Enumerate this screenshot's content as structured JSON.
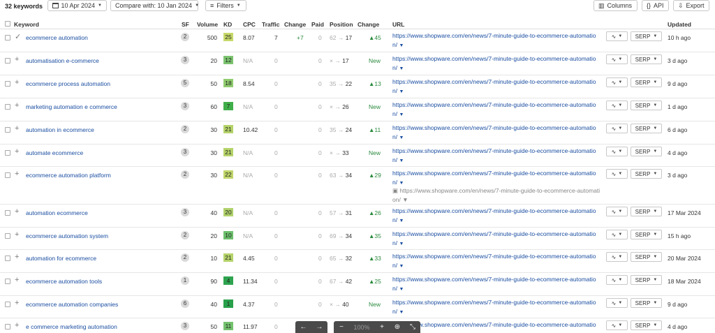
{
  "toolbar": {
    "keyword_count": "32 keywords",
    "date_label": "10 Apr 2024",
    "compare_label": "Compare with: 10 Jan 2024",
    "filters_label": "Filters",
    "columns_label": "Columns",
    "api_label": "API",
    "export_label": "Export"
  },
  "headers": {
    "keyword": "Keyword",
    "sf": "SF",
    "volume": "Volume",
    "kd": "KD",
    "cpc": "CPC",
    "traffic": "Traffic",
    "change": "Change",
    "paid": "Paid",
    "position": "Position",
    "pos_change": "Change",
    "url": "URL",
    "updated": "Updated"
  },
  "serp_label": "SERP",
  "rows": [
    {
      "keyword": "ecommerce automation",
      "sf": "2",
      "volume": "500",
      "kd": "25",
      "kd_color": "#c7d96b",
      "cpc": "8.07",
      "traffic": "7",
      "traffic_change": "+7",
      "paid": "0",
      "pos_from": "62",
      "pos_to": "17",
      "pos_change": "▲45",
      "url": "https://www.shopware.com/en/news/7-minute-guide-to-ecommerce-automatio n/",
      "updated": "10 h ago"
    },
    {
      "keyword": "automatisation e-commerce",
      "sf": "3",
      "volume": "20",
      "kd": "12",
      "kd_color": "#7cc46f",
      "cpc": "N/A",
      "traffic": "0",
      "traffic_change": "",
      "paid": "0",
      "pos_from": "×",
      "pos_to": "17",
      "pos_change": "New",
      "url": "https://www.shopware.com/en/news/7-minute-guide-to-ecommerce-automatio n/",
      "updated": "3 d ago"
    },
    {
      "keyword": "ecommerce process automation",
      "sf": "5",
      "volume": "50",
      "kd": "18",
      "kd_color": "#8fcc6e",
      "cpc": "8.54",
      "traffic": "0",
      "traffic_change": "",
      "paid": "0",
      "pos_from": "35",
      "pos_to": "22",
      "pos_change": "▲13",
      "url": "https://www.shopware.com/en/news/7-minute-guide-to-ecommerce-automatio n/",
      "updated": "9 d ago"
    },
    {
      "keyword": "marketing automation e commerce",
      "sf": "3",
      "volume": "60",
      "kd": "7",
      "kd_color": "#3fae49",
      "cpc": "N/A",
      "traffic": "0",
      "traffic_change": "",
      "paid": "0",
      "pos_from": "×",
      "pos_to": "26",
      "pos_change": "New",
      "url": "https://www.shopware.com/en/news/7-minute-guide-to-ecommerce-automatio n/",
      "updated": "1 d ago"
    },
    {
      "keyword": "automation in ecommerce",
      "sf": "2",
      "volume": "30",
      "kd": "21",
      "kd_color": "#b5d36a",
      "cpc": "10.42",
      "traffic": "0",
      "traffic_change": "",
      "paid": "0",
      "pos_from": "35",
      "pos_to": "24",
      "pos_change": "▲11",
      "url": "https://www.shopware.com/en/news/7-minute-guide-to-ecommerce-automatio n/",
      "updated": "6 d ago"
    },
    {
      "keyword": "automate ecommerce",
      "sf": "3",
      "volume": "30",
      "kd": "21",
      "kd_color": "#b5d36a",
      "cpc": "N/A",
      "traffic": "0",
      "traffic_change": "",
      "paid": "0",
      "pos_from": "×",
      "pos_to": "33",
      "pos_change": "New",
      "url": "https://www.shopware.com/en/news/7-minute-guide-to-ecommerce-automatio n/",
      "updated": "4 d ago"
    },
    {
      "keyword": "ecommerce automation platform",
      "sf": "2",
      "volume": "30",
      "kd": "22",
      "kd_color": "#c0d66b",
      "cpc": "N/A",
      "traffic": "0",
      "traffic_change": "",
      "paid": "0",
      "pos_from": "63",
      "pos_to": "34",
      "pos_change": "▲29",
      "url": "https://www.shopware.com/en/news/7-minute-guide-to-ecommerce-automatio n/",
      "url_secondary": "https://www.shopware.com/en/news/7-minute-guide-to-ecommerce-automation/",
      "updated": "3 d ago"
    },
    {
      "keyword": "automation ecommerce",
      "sf": "3",
      "volume": "40",
      "kd": "20",
      "kd_color": "#b0d16b",
      "cpc": "N/A",
      "traffic": "0",
      "traffic_change": "",
      "paid": "0",
      "pos_from": "57",
      "pos_to": "31",
      "pos_change": "▲26",
      "url": "https://www.shopware.com/en/news/7-minute-guide-to-ecommerce-automatio n/",
      "updated": "17 Mar 2024"
    },
    {
      "keyword": "ecommerce automation system",
      "sf": "2",
      "volume": "20",
      "kd": "10",
      "kd_color": "#6cbf6c",
      "cpc": "N/A",
      "traffic": "0",
      "traffic_change": "",
      "paid": "0",
      "pos_from": "69",
      "pos_to": "34",
      "pos_change": "▲35",
      "url": "https://www.shopware.com/en/news/7-minute-guide-to-ecommerce-automatio n/",
      "updated": "15 h ago"
    },
    {
      "keyword": "automation for ecommerce",
      "sf": "2",
      "volume": "10",
      "kd": "21",
      "kd_color": "#b5d36a",
      "cpc": "4.45",
      "traffic": "0",
      "traffic_change": "",
      "paid": "0",
      "pos_from": "65",
      "pos_to": "32",
      "pos_change": "▲33",
      "url": "https://www.shopware.com/en/news/7-minute-guide-to-ecommerce-automatio n/",
      "updated": "20 Mar 2024"
    },
    {
      "keyword": "ecommerce automation tools",
      "sf": "1",
      "volume": "90",
      "kd": "4",
      "kd_color": "#2ea44f",
      "cpc": "11.34",
      "traffic": "0",
      "traffic_change": "",
      "paid": "0",
      "pos_from": "67",
      "pos_to": "42",
      "pos_change": "▲25",
      "url": "https://www.shopware.com/en/news/7-minute-guide-to-ecommerce-automatio n/",
      "updated": "18 Mar 2024"
    },
    {
      "keyword": "ecommerce automation companies",
      "sf": "6",
      "volume": "40",
      "kd": "1",
      "kd_color": "#27a04a",
      "cpc": "4.37",
      "traffic": "0",
      "traffic_change": "",
      "paid": "0",
      "pos_from": "×",
      "pos_to": "40",
      "pos_change": "New",
      "url": "https://www.shopware.com/en/news/7-minute-guide-to-ecommerce-automatio n/",
      "updated": "9 d ago"
    },
    {
      "keyword": "e commerce marketing automation",
      "sf": "3",
      "volume": "50",
      "kd": "11",
      "kd_color": "#74c26e",
      "cpc": "11.97",
      "traffic": "0",
      "traffic_change": "",
      "paid": "0",
      "pos_from": "",
      "pos_to": "",
      "pos_change": "",
      "url": "https://www.shopware.com/en/news/7-minute-guide-to-ecommerce-automatio",
      "updated": "4 d ago"
    }
  ],
  "viewer": {
    "zoom": "100%"
  }
}
